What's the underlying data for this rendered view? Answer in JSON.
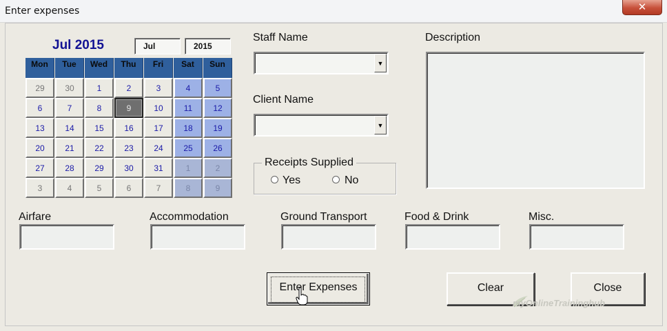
{
  "window": {
    "title": "Enter expenses",
    "close_glyph": "✕"
  },
  "calendar": {
    "title": "Jul 2015",
    "month_select": "Jul",
    "year_select": "2015",
    "weekdays": [
      "Mon",
      "Tue",
      "Wed",
      "Thu",
      "Fri",
      "Sat",
      "Sun"
    ],
    "weeks": [
      [
        "29",
        "30",
        "1",
        "2",
        "3",
        "4",
        "5"
      ],
      [
        "6",
        "7",
        "8",
        "9",
        "10",
        "11",
        "12"
      ],
      [
        "13",
        "14",
        "15",
        "16",
        "17",
        "18",
        "19"
      ],
      [
        "20",
        "21",
        "22",
        "23",
        "24",
        "25",
        "26"
      ],
      [
        "27",
        "28",
        "29",
        "30",
        "31",
        "1",
        "2"
      ],
      [
        "3",
        "4",
        "5",
        "6",
        "7",
        "8",
        "9"
      ]
    ],
    "selected_day": "9"
  },
  "staff": {
    "label": "Staff Name",
    "value": ""
  },
  "client": {
    "label": "Client Name",
    "value": ""
  },
  "receipts": {
    "legend": "Receipts Supplied",
    "options": [
      "Yes",
      "No"
    ]
  },
  "description": {
    "label": "Description",
    "value": ""
  },
  "expense_fields": [
    {
      "label": "Airfare",
      "value": ""
    },
    {
      "label": "Accommodation",
      "value": ""
    },
    {
      "label": "Ground Transport",
      "value": ""
    },
    {
      "label": "Food & Drink",
      "value": ""
    },
    {
      "label": "Misc.",
      "value": ""
    }
  ],
  "buttons": {
    "enter": "Enter Expenses",
    "clear": "Clear",
    "close": "Close"
  },
  "watermark": "myOnlineTraininghub",
  "colors": {
    "header_blue": "#2f5f9c",
    "weekend_blue": "#9db1e6",
    "title_navy": "#121294"
  }
}
